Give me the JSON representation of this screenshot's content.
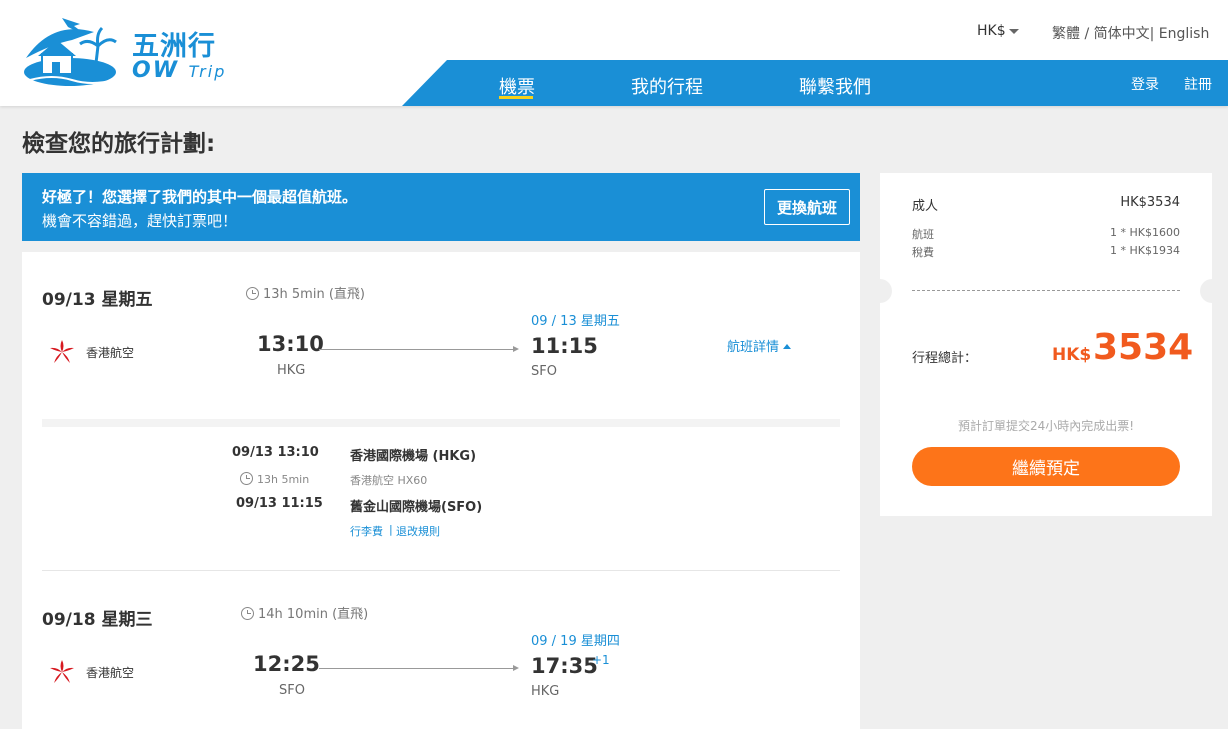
{
  "brand": {
    "name_cn": "五洲行",
    "name_en_a": "OW",
    "name_en_b": "Trip"
  },
  "header": {
    "currency": "HK$",
    "lang_tc": "繁體",
    "lang_sep1": "/",
    "lang_sc": "简体中文",
    "lang_sep2": "|",
    "lang_en": "English",
    "nav": [
      "機票",
      "我的行程",
      "聯繫我們"
    ],
    "login": "登录",
    "register": "註冊"
  },
  "page_title": "檢查您的旅行計劃:",
  "banner": {
    "line1": "好極了！您選擇了我們的其中一個最超值航班。",
    "line2": "機會不容錯過，趕快訂票吧！",
    "change_btn": "更換航班"
  },
  "outbound": {
    "date": "09/13 星期五",
    "duration": "13h 5min (直飛)",
    "airline": "香港航空",
    "dep_time": "13:10",
    "dep_apt": "HKG",
    "arr_date": "09 / 13 星期五",
    "arr_time": "11:15",
    "arr_apt": "SFO",
    "detail_link": "航班詳情",
    "segment": {
      "dep_dt": "09/13 13:10",
      "dep_airport": "香港國際機場 (HKG)",
      "duration": "13h 5min",
      "flight": "香港航空 HX60",
      "arr_dt": "09/13 11:15",
      "arr_airport": "舊金山國際機場(SFO)",
      "luggage": "行李費",
      "sep": "|",
      "rules": "退改規則"
    }
  },
  "return": {
    "date": "09/18 星期三",
    "duration": "14h 10min (直飛)",
    "airline": "香港航空",
    "dep_time": "12:25",
    "dep_apt": "SFO",
    "arr_date": "09 / 19 星期四",
    "arr_time": "17:35",
    "plus_day": "+1",
    "arr_apt": "HKG"
  },
  "price": {
    "adult_label": "成人",
    "adult_price": "HK$3534",
    "flight_label": "航班",
    "flight_price": "1 * HK$1600",
    "tax_label": "稅費",
    "tax_price": "1 * HK$1934",
    "total_label": "行程總計：",
    "total_currency": "HK$",
    "total_amount": "3534",
    "note": "預計訂單提交24小時內完成出票!",
    "cta": "繼續預定"
  },
  "colors": {
    "brand_blue": "#1a8fd6",
    "cta_orange": "#fd7419",
    "price_red": "#f15a1e",
    "nav_underline": "#f7d21a"
  }
}
